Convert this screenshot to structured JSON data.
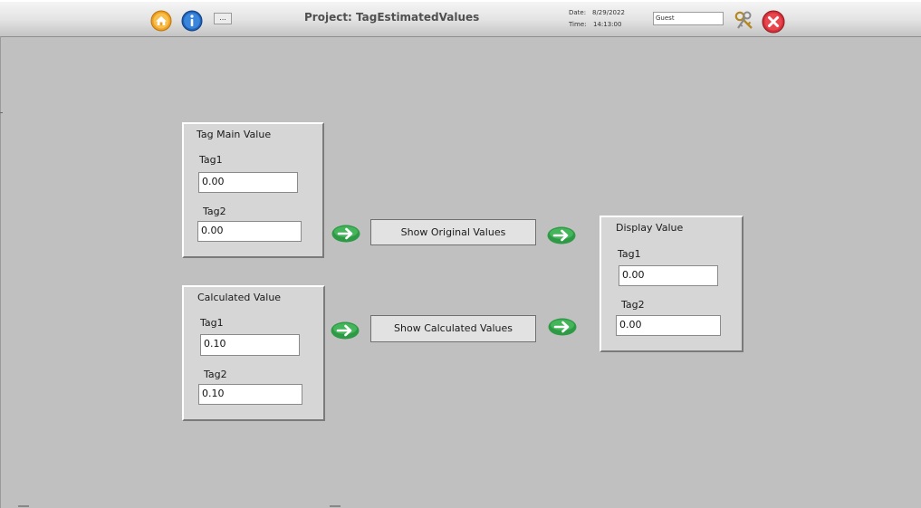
{
  "header": {
    "title": "Project: TagEstimatedValues",
    "date_label": "Date:",
    "date_value": "8/29/2022",
    "time_label": "Time:",
    "time_value": "14:13:00",
    "user": "Guest",
    "more_label": "..."
  },
  "icons": {
    "home": "home-icon",
    "info": "info-icon",
    "keys": "keys-icon",
    "close": "close-icon",
    "arrow": "arrow-right-icon"
  },
  "colors": {
    "arrow_green": "#2e9a45",
    "close_red": "#d5313a",
    "info_blue": "#1f64b9",
    "home_orange": "#f0a020"
  },
  "tag_main": {
    "title": "Tag Main Value",
    "tag1_label": "Tag1",
    "tag1_value": "0.00",
    "tag2_label": "Tag2",
    "tag2_value": "0.00"
  },
  "calculated": {
    "title": "Calculated Value",
    "tag1_label": "Tag1",
    "tag1_value": "0.10",
    "tag2_label": "Tag2",
    "tag2_value": "0.10"
  },
  "display": {
    "title": "Display Value",
    "tag1_label": "Tag1",
    "tag1_value": "0.00",
    "tag2_label": "Tag2",
    "tag2_value": "0.00"
  },
  "buttons": {
    "show_original": "Show Original Values",
    "show_calculated": "Show Calculated Values"
  }
}
